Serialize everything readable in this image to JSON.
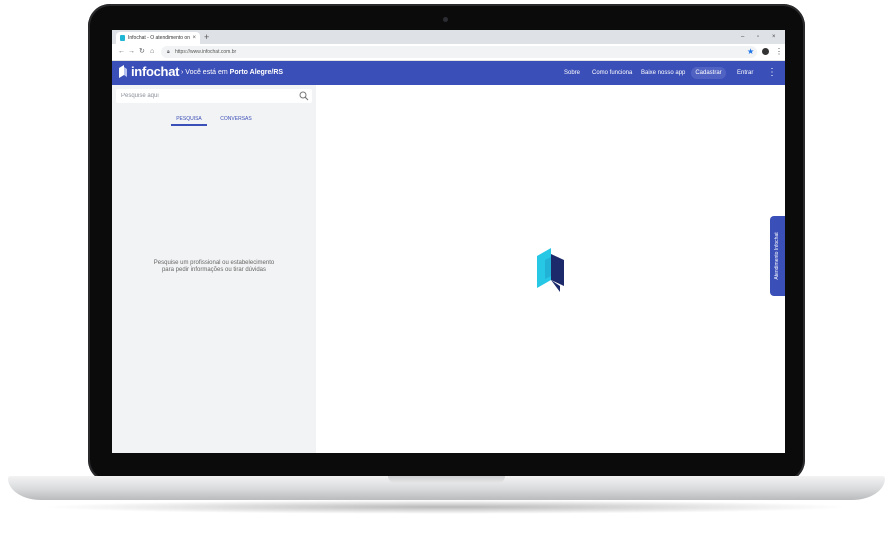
{
  "browser": {
    "tab_title": "Infochat - O atendimento online",
    "tab_close": "×",
    "new_tab": "+",
    "url": "https://www.infochat.com.br",
    "window_controls": {
      "minimize": "–",
      "restore": "▫",
      "close": "×"
    }
  },
  "header": {
    "logo_text": "infochat",
    "location_prefix": "Você está em",
    "location_city": "Porto Alegre/RS",
    "nav": [
      "Sobre",
      "Como funciona",
      "Baixe nosso app"
    ],
    "signup_label": "Cadastrar",
    "login_label": "Entrar",
    "menu_icon": "⋮"
  },
  "sidebar": {
    "search_placeholder": "Pesquise aqui",
    "tabs": [
      "PESQUISA",
      "CONVERSAS"
    ],
    "empty_message_line1": "Pesquise um profissional ou estabelecimento",
    "empty_message_line2": "para pedir informações ou tirar dúvidas"
  },
  "side_tab_label": "Atendimento Infochat",
  "colors": {
    "brand": "#3b4fb8",
    "logo_cyan": "#1fb5d5",
    "logo_navy": "#1c2a6b"
  }
}
